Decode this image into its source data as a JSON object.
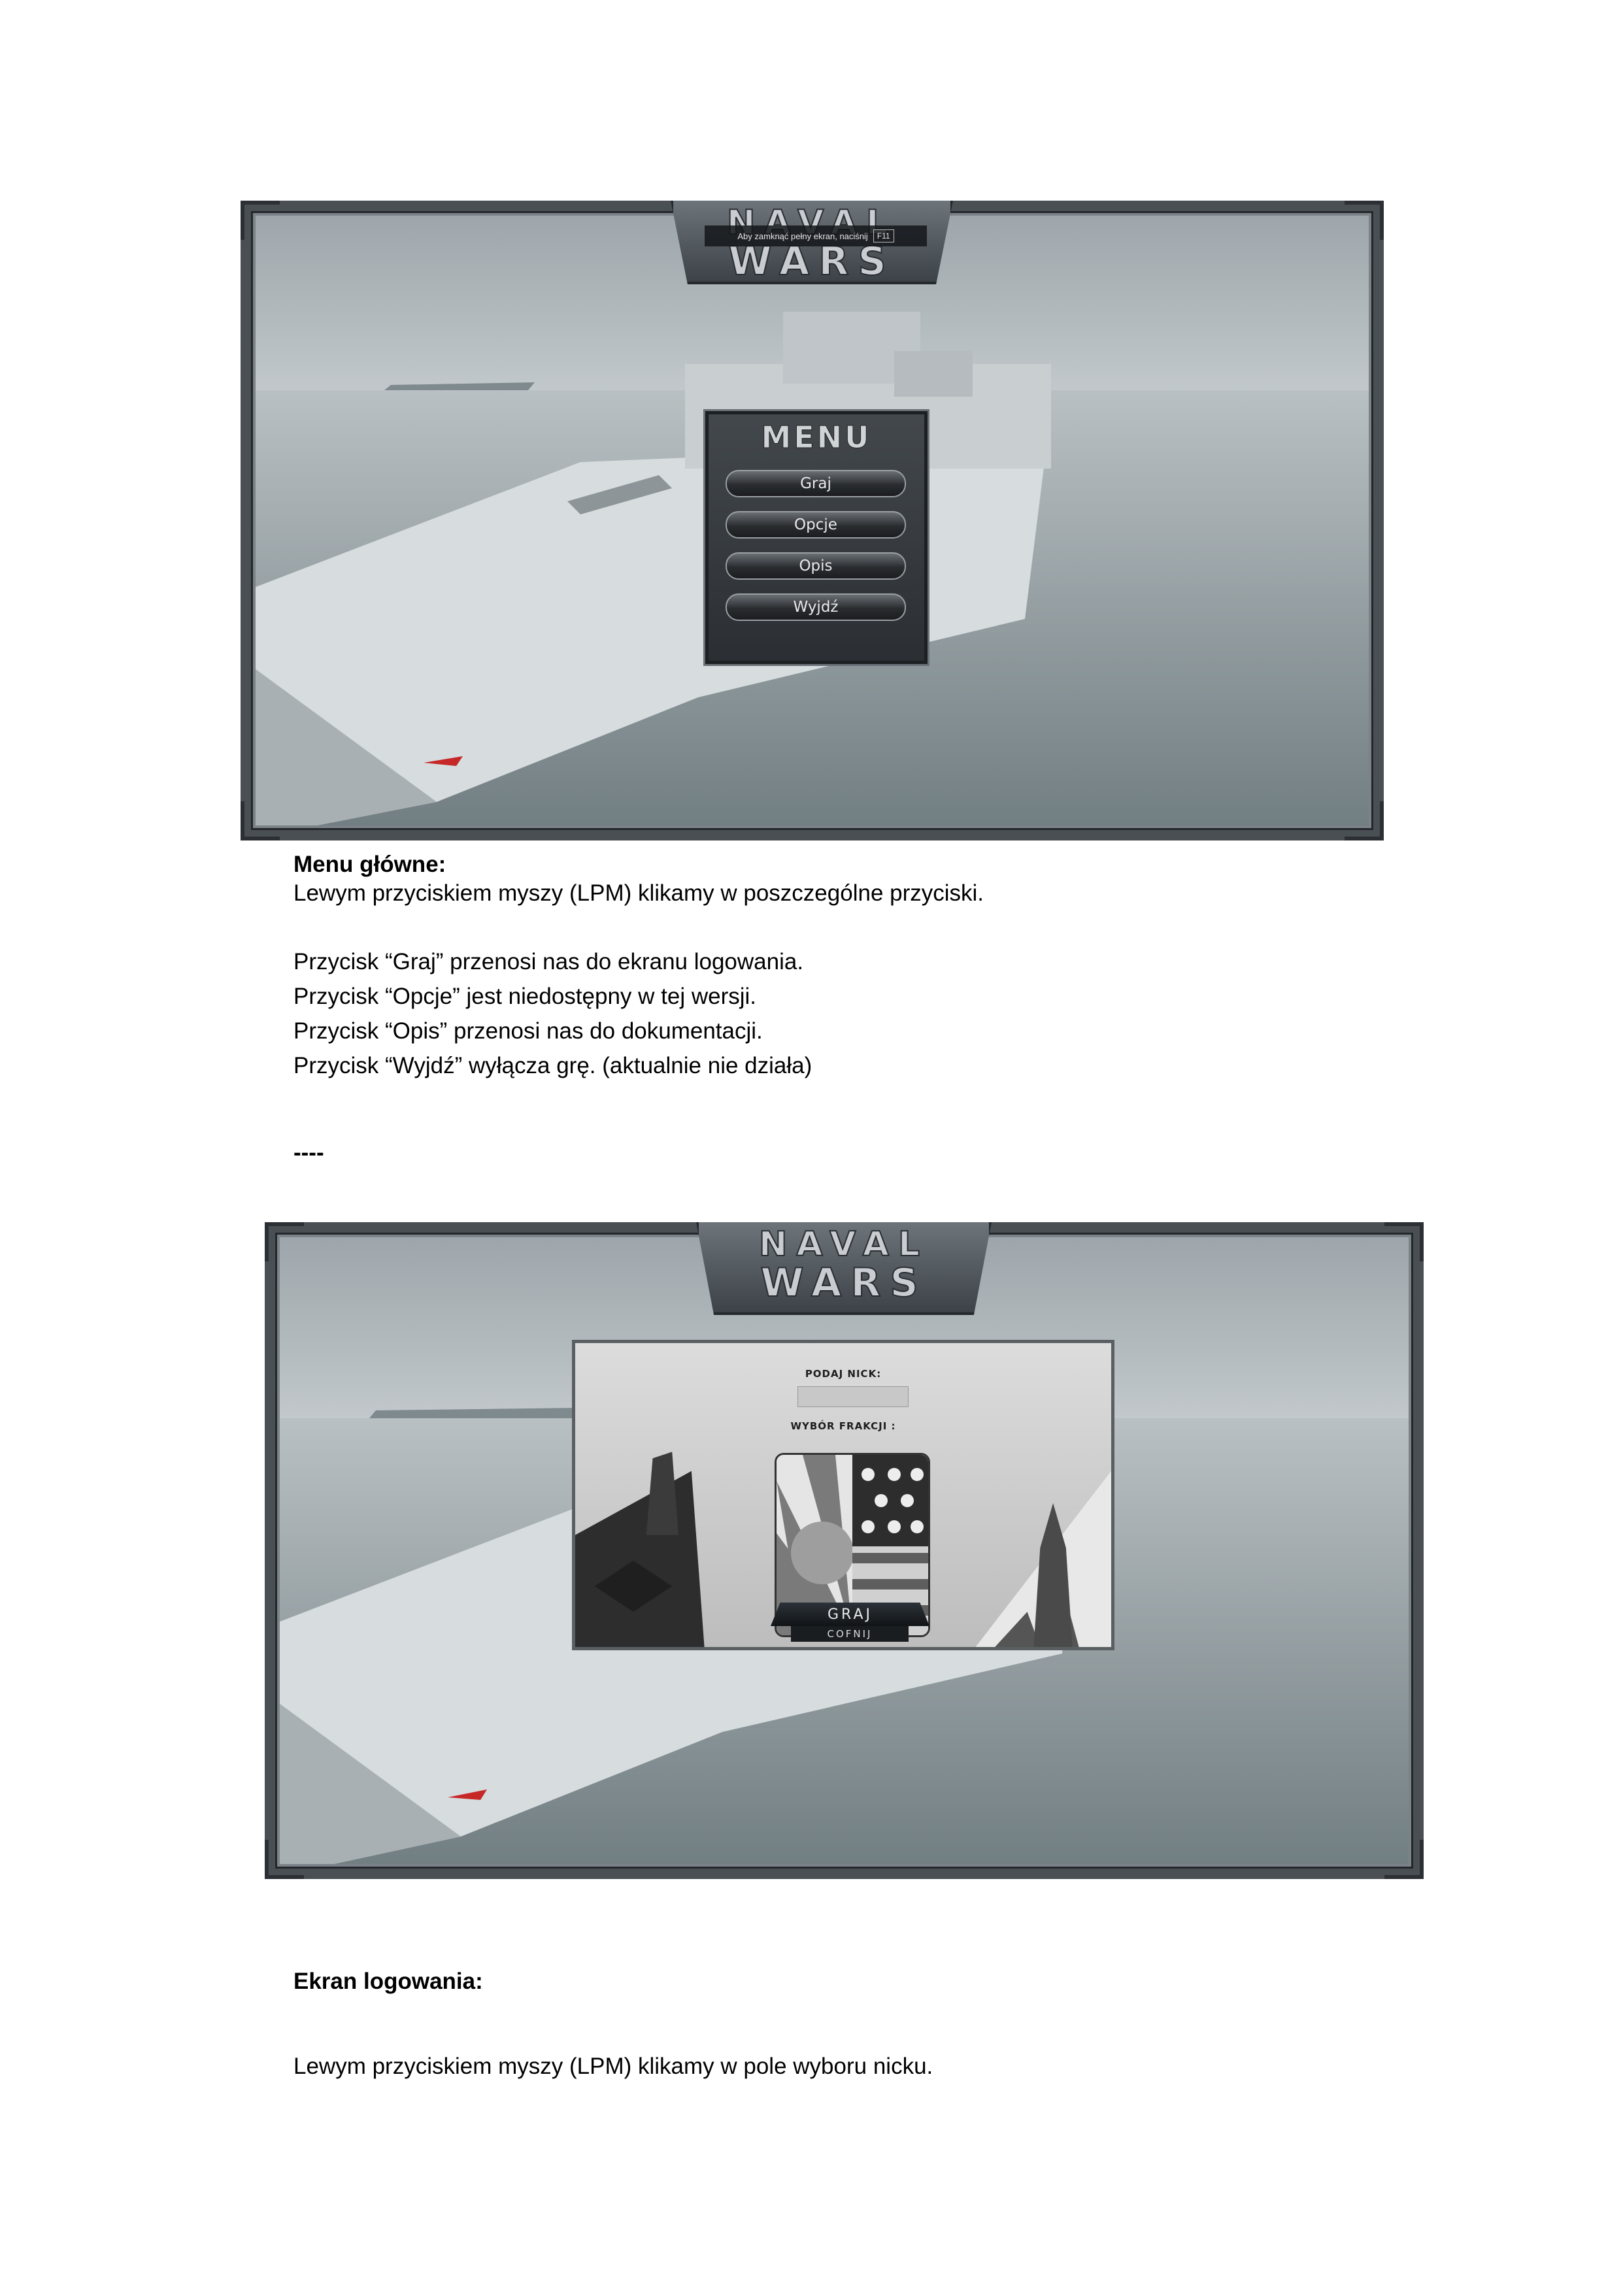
{
  "screenshot1": {
    "logo_line1": "NAVAL",
    "logo_line2": "WARS",
    "fullscreen_hint": "Aby zamknąć pełny ekran, naciśnij",
    "fullscreen_key": "F11",
    "menu_title": "MENU",
    "buttons": [
      "Graj",
      "Opcje",
      "Opis",
      "Wyjdź"
    ]
  },
  "section1": {
    "heading": "Menu główne:",
    "intro": "Lewym przyciskiem myszy (LPM) klikamy w poszczególne przyciski.",
    "lines": [
      "Przycisk “Graj” przenosi nas do ekranu logowania.",
      "Przycisk “Opcje” jest niedostępny w tej wersji.",
      "Przycisk “Opis” przenosi nas do dokumentacji.",
      "Przycisk “Wyjdź” wyłącza grę. (aktualnie nie działa)"
    ],
    "separator": "----"
  },
  "screenshot2": {
    "logo_line1": "NAVAL",
    "logo_line2": "WARS",
    "nick_label": "PODAJ NICK:",
    "faction_label": "WYBÓR FRAKCJI :",
    "play_button": "GRAJ",
    "back_button": "COFNIJ"
  },
  "section2": {
    "heading": "Ekran logowania:",
    "intro": "Lewym przyciskiem myszy (LPM) klikamy w pole wyboru nicku."
  }
}
